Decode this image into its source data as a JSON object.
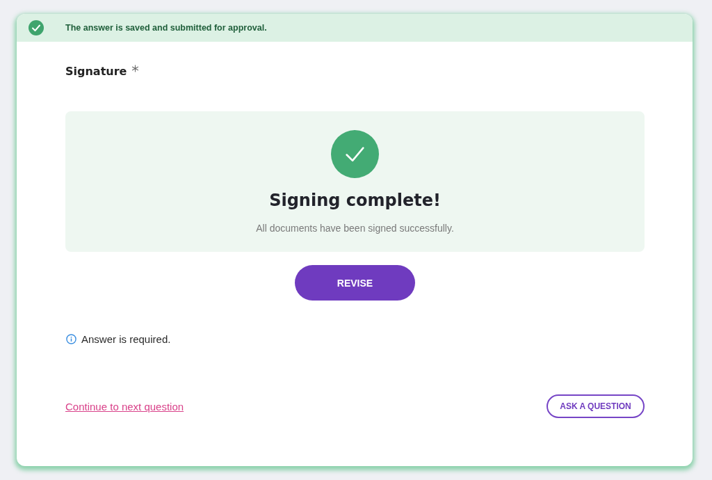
{
  "banner": {
    "message": "The answer is saved and submitted for approval."
  },
  "question": {
    "label": "Signature",
    "required": true
  },
  "status_panel": {
    "title": "Signing complete!",
    "message": "All documents have been signed successfully."
  },
  "revise_button": {
    "label": "REVISE"
  },
  "validation": {
    "message": "Answer is required."
  },
  "footer": {
    "continue_link": "Continue to next question",
    "ask_button": "ASK A QUESTION"
  }
}
